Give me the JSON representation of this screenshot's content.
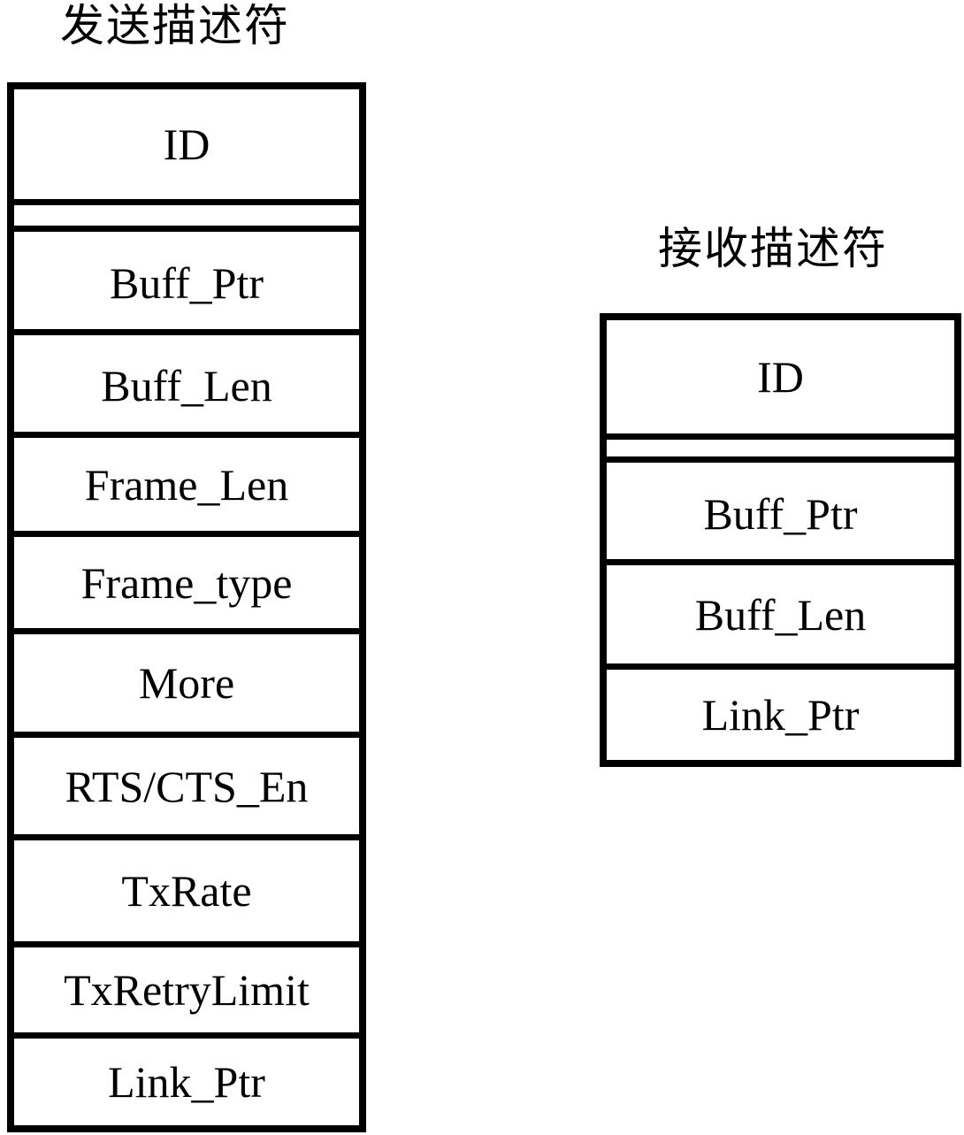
{
  "diagram": {
    "transmit_descriptor": {
      "title": "发送描述符",
      "fields": [
        {
          "label": "ID"
        },
        {
          "label": ""
        },
        {
          "label": "Buff_Ptr"
        },
        {
          "label": "Buff_Len"
        },
        {
          "label": "Frame_Len"
        },
        {
          "label": "Frame_type"
        },
        {
          "label": "More"
        },
        {
          "label": "RTS/CTS_En"
        },
        {
          "label": "TxRate"
        },
        {
          "label": "TxRetryLimit"
        },
        {
          "label": "Link_Ptr"
        }
      ]
    },
    "receive_descriptor": {
      "title": "接收描述符",
      "fields": [
        {
          "label": "ID"
        },
        {
          "label": ""
        },
        {
          "label": "Buff_Ptr"
        },
        {
          "label": "Buff_Len"
        },
        {
          "label": "Link_Ptr"
        }
      ]
    }
  }
}
